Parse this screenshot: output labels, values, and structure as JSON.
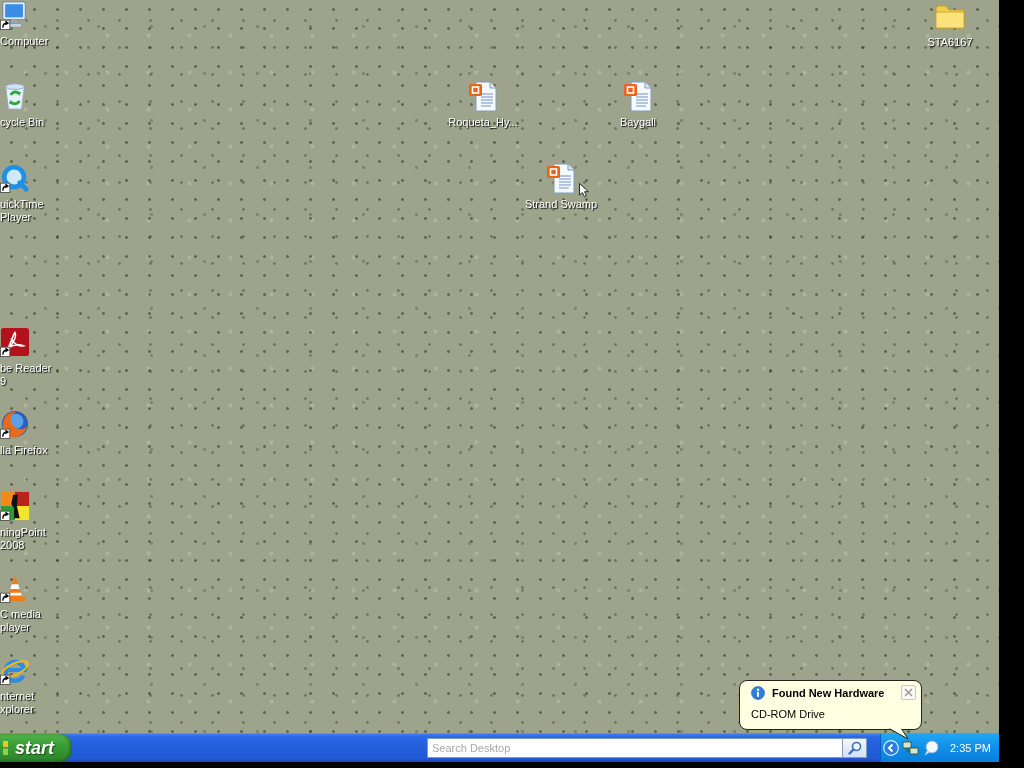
{
  "desktop": {
    "icons": [
      {
        "label": "Computer",
        "kind": "computer",
        "shortcut": true
      },
      {
        "label": "cycle Bin",
        "kind": "recycle_bin",
        "shortcut": false
      },
      {
        "label": "uickTime\nPlayer",
        "kind": "q_player",
        "shortcut": true
      },
      {
        "label": "be Reader\n9",
        "kind": "pdf_reader",
        "shortcut": true
      },
      {
        "label": "lla Firefox",
        "kind": "fox_browser",
        "shortcut": true
      },
      {
        "label": "ningPoint\n2008",
        "kind": "clicker",
        "shortcut": true
      },
      {
        "label": "C media\nplayer",
        "kind": "cone",
        "shortcut": true
      },
      {
        "label": "nternet\nxplorer",
        "kind": "e_browser",
        "shortcut": true
      },
      {
        "label": "Roqueta_Hy...",
        "kind": "slides",
        "shortcut": false
      },
      {
        "label": "Baygall",
        "kind": "slides",
        "shortcut": false
      },
      {
        "label": "Strand Swamp",
        "kind": "slides",
        "shortcut": false
      },
      {
        "label": "STA6167",
        "kind": "folder",
        "shortcut": false
      }
    ]
  },
  "notification": {
    "title": "Found New Hardware",
    "text": "CD-ROM Drive"
  },
  "taskbar": {
    "start": "start",
    "search": {
      "placeholder": "Search Desktop"
    },
    "clock": "2:35 PM"
  }
}
